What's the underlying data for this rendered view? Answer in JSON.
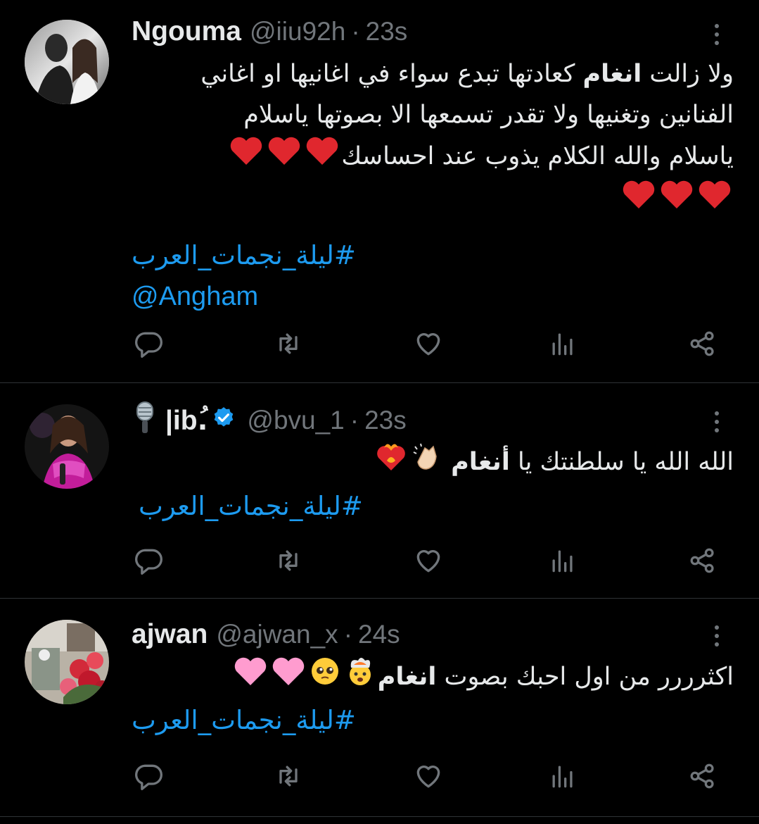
{
  "colors": {
    "background": "#000000",
    "text": "#e7e9ea",
    "secondary": "#71767b",
    "link": "#1d9bf0",
    "divider": "#2f3336",
    "verified": "#1d9bf0"
  },
  "tweets": [
    {
      "name": "Ngouma",
      "handle": "@iiu92h",
      "separator": "·",
      "time": "23s",
      "lines": [
        {
          "pre": "ولا زالت ",
          "bold": "انغام",
          "post": " كعادتها تبدع سواء في اغانيها او اغاني"
        },
        {
          "pre": "الفنانين وتغنيها ولا تقدر تسمعها الا بصوتها ياسلام",
          "bold": "",
          "post": ""
        },
        {
          "pre": "ياسلام والله الكلام يذوب عند احساسك",
          "bold": "",
          "post": ""
        }
      ],
      "emojis_line3": [
        "red-heart",
        "red-heart",
        "red-heart"
      ],
      "emojis_line4": [
        "red-heart",
        "red-heart",
        "red-heart"
      ],
      "hashtag": "#ليلة_نجمات_العرب",
      "mention": "@Angham"
    },
    {
      "name": "|ib.ُ",
      "name_icon": "microphone",
      "handle": "@bvu_1",
      "separator": "·",
      "time": "23s",
      "verified": true,
      "lines": [
        {
          "pre": "الله الله يا سلطنتك يا ",
          "bold": "أنغام",
          "post": ""
        }
      ],
      "emojis_line1": [
        "clapping-hands",
        "heart-on-fire"
      ],
      "hashtag": "#ليلة_نجمات_العرب"
    },
    {
      "name": "ajwan",
      "handle": "@ajwan_x",
      "separator": "·",
      "time": "24s",
      "lines": [
        {
          "pre": "اكثرررر من اول احبك بصوت ",
          "bold": "انغام",
          "post": ""
        }
      ],
      "emojis_line1": [
        "exploding-head",
        "pleading-face",
        "pink-heart",
        "pink-heart"
      ],
      "hashtag": "#ليلة_نجمات_العرب"
    }
  ],
  "action_icons": [
    "reply-icon",
    "retweet-icon",
    "like-icon",
    "views-icon",
    "share-icon"
  ]
}
